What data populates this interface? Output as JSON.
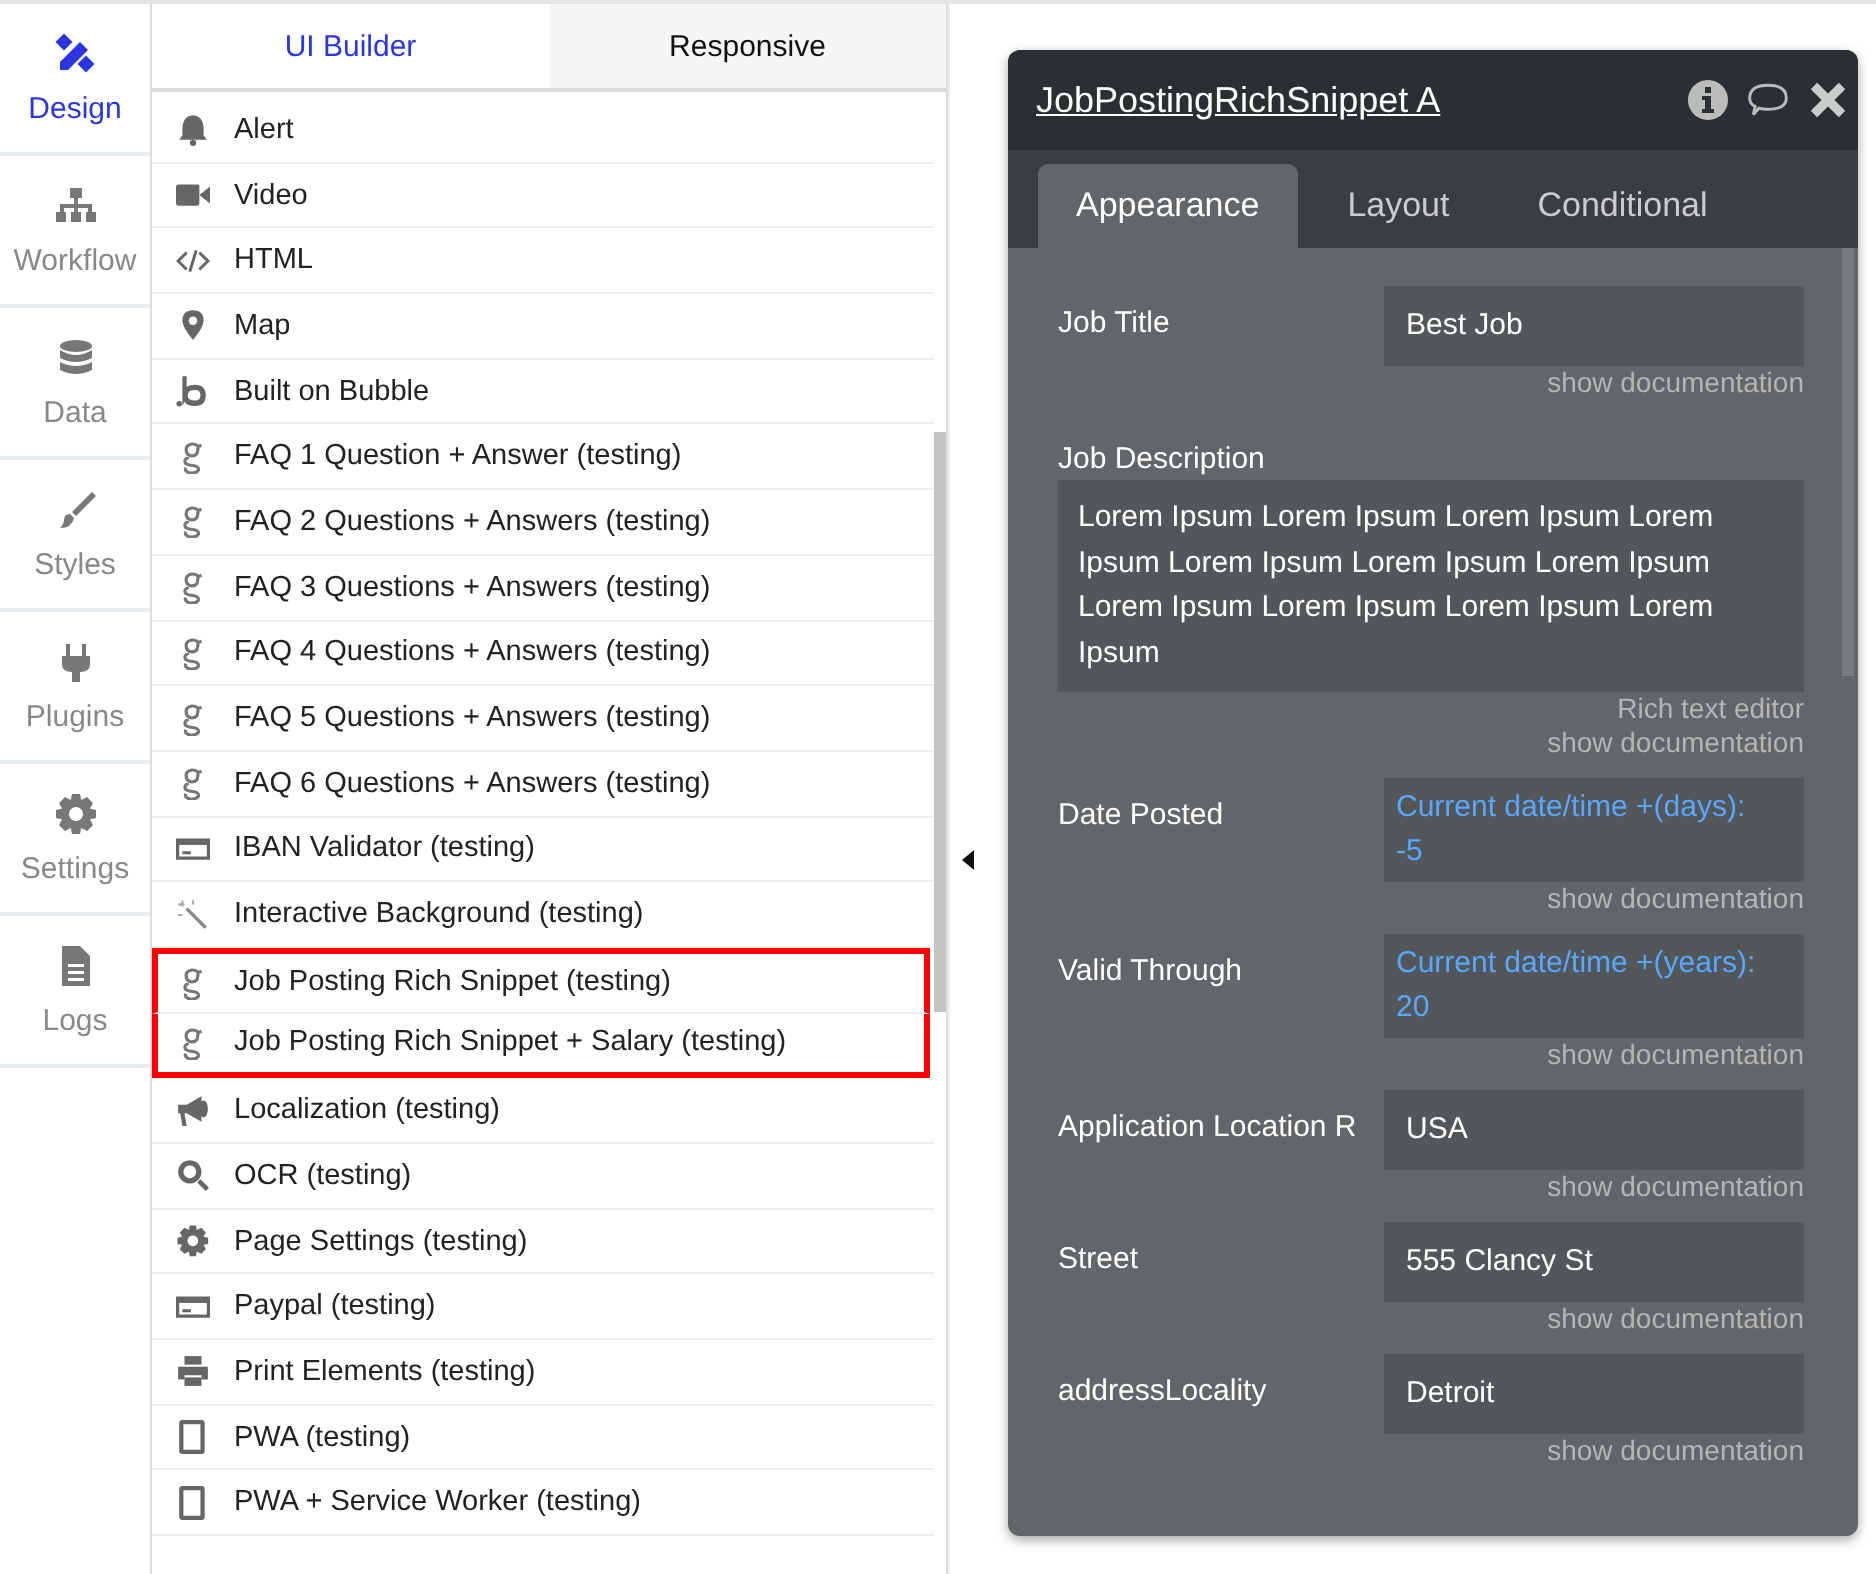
{
  "sidebar": {
    "items": [
      {
        "label": "Design",
        "kind": "design",
        "selected": true
      },
      {
        "label": "Workflow",
        "kind": "workflow",
        "selected": false
      },
      {
        "label": "Data",
        "kind": "data",
        "selected": false
      },
      {
        "label": "Styles",
        "kind": "styles",
        "selected": false
      },
      {
        "label": "Plugins",
        "kind": "plugins",
        "selected": false
      },
      {
        "label": "Settings",
        "kind": "settings",
        "selected": false
      },
      {
        "label": "Logs",
        "kind": "logs",
        "selected": false
      }
    ]
  },
  "palette": {
    "tabs": [
      {
        "label": "UI Builder",
        "selected": true
      },
      {
        "label": "Responsive",
        "selected": false
      }
    ],
    "items": [
      {
        "label": "Alert",
        "kind": "bell",
        "highlighted": false
      },
      {
        "label": "Video",
        "kind": "video",
        "highlighted": false
      },
      {
        "label": "HTML",
        "kind": "code",
        "highlighted": false
      },
      {
        "label": "Map",
        "kind": "pin",
        "highlighted": false
      },
      {
        "label": "Built on Bubble",
        "kind": "bubble",
        "highlighted": false
      },
      {
        "label": "FAQ 1 Question + Answer (testing)",
        "kind": "plugin",
        "highlighted": false
      },
      {
        "label": "FAQ 2 Questions + Answers (testing)",
        "kind": "plugin",
        "highlighted": false
      },
      {
        "label": "FAQ 3 Questions + Answers (testing)",
        "kind": "plugin",
        "highlighted": false
      },
      {
        "label": "FAQ 4 Questions + Answers (testing)",
        "kind": "plugin",
        "highlighted": false
      },
      {
        "label": "FAQ 5 Questions + Answers (testing)",
        "kind": "plugin",
        "highlighted": false
      },
      {
        "label": "FAQ 6 Questions + Answers (testing)",
        "kind": "plugin",
        "highlighted": false
      },
      {
        "label": "IBAN Validator (testing)",
        "kind": "card",
        "highlighted": false
      },
      {
        "label": "Interactive Background (testing)",
        "kind": "wand",
        "highlighted": false
      },
      {
        "label": "Job Posting Rich Snippet (testing)",
        "kind": "plugin",
        "highlighted": true
      },
      {
        "label": "Job Posting Rich Snippet + Salary (testing)",
        "kind": "plugin",
        "highlighted": true
      },
      {
        "label": "Localization (testing)",
        "kind": "megaphone",
        "highlighted": false
      },
      {
        "label": "OCR (testing)",
        "kind": "search",
        "highlighted": false
      },
      {
        "label": "Page Settings (testing)",
        "kind": "gear",
        "highlighted": false
      },
      {
        "label": "Paypal (testing)",
        "kind": "card",
        "highlighted": false
      },
      {
        "label": "Print Elements (testing)",
        "kind": "printer",
        "highlighted": false
      },
      {
        "label": "PWA (testing)",
        "kind": "phone",
        "highlighted": false
      },
      {
        "label": "PWA + Service Worker (testing)",
        "kind": "phone",
        "highlighted": false
      }
    ]
  },
  "property_editor": {
    "title": "JobPostingRichSnippet A",
    "tabs": [
      {
        "label": "Appearance",
        "selected": true
      },
      {
        "label": "Layout",
        "selected": false
      },
      {
        "label": "Conditional",
        "selected": false
      }
    ],
    "fields": [
      {
        "kind": "text",
        "label": "Job Title",
        "value": "Best Job",
        "notes": [
          "show documentation"
        ]
      },
      {
        "kind": "wide",
        "label": "Job Description",
        "value": "Lorem Ipsum Lorem Ipsum Lorem Ipsum Lorem Ipsum Lorem Ipsum Lorem Ipsum Lorem Ipsum Lorem Ipsum Lorem Ipsum Lorem Ipsum Lorem Ipsum",
        "notes": [
          "Rich text editor",
          "show documentation"
        ]
      },
      {
        "kind": "dynamic",
        "label": "Date Posted",
        "value": "Current date/time +(days): -5",
        "notes": [
          "show documentation"
        ]
      },
      {
        "kind": "dynamic",
        "label": "Valid Through",
        "value": "Current date/time +(years): 20",
        "notes": [
          "show documentation"
        ]
      },
      {
        "kind": "text",
        "label": "Application Location R",
        "value": "USA",
        "notes": [
          "show documentation"
        ]
      },
      {
        "kind": "text",
        "label": "Street",
        "value": "555 Clancy St",
        "notes": [
          "show documentation"
        ]
      },
      {
        "kind": "text",
        "label": "addressLocality",
        "value": "Detroit",
        "notes": [
          "show documentation"
        ]
      }
    ]
  }
}
